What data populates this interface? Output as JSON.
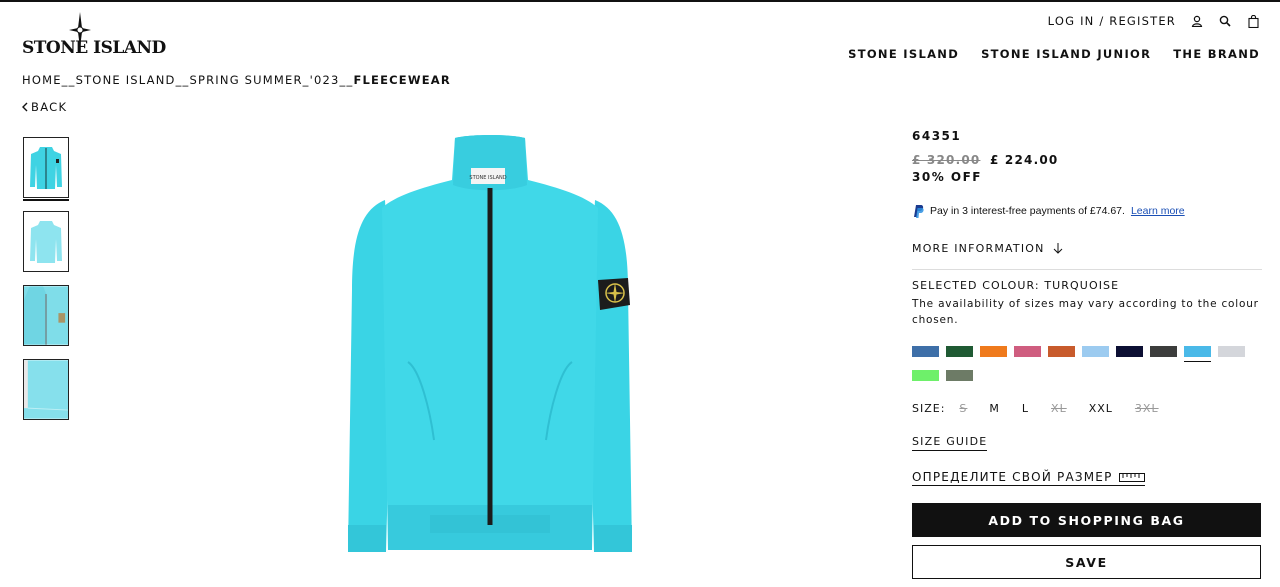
{
  "brand": {
    "logo_text": "STONE ISLAND"
  },
  "header": {
    "login_label": "LOG IN / REGISTER",
    "icons": [
      "user-icon",
      "search-icon",
      "bag-icon"
    ],
    "nav": [
      "STONE ISLAND",
      "STONE ISLAND JUNIOR",
      "THE BRAND"
    ]
  },
  "breadcrumb": {
    "path": "HOME__STONE ISLAND__SPRING SUMMER_'023__",
    "current": "FLEECEWEAR"
  },
  "back_label": "BACK",
  "gallery": {
    "thumb_count": 4,
    "selected_index": 0,
    "product_color": "#3fd3e3"
  },
  "product": {
    "sku": "64351",
    "price_original": "£ 320.00",
    "price_sale": "£ 224.00",
    "discount": "30% OFF",
    "paypal_text": "Pay in 3 interest-free payments of £74.67.",
    "paypal_link": "Learn more",
    "more_info_label": "MORE INFORMATION",
    "selected_colour": "SELECTED COLOUR: TURQUOISE",
    "availability_note": "The availability of sizes may vary according to the colour chosen.",
    "colours": [
      {
        "name": "blue",
        "hex": "#3e6fa8",
        "selected": false
      },
      {
        "name": "green",
        "hex": "#1f5a33",
        "selected": false
      },
      {
        "name": "orange",
        "hex": "#ef7a1c",
        "selected": false
      },
      {
        "name": "pink",
        "hex": "#cf5d7f",
        "selected": false
      },
      {
        "name": "rust",
        "hex": "#c85b2c",
        "selected": false
      },
      {
        "name": "sky-blue",
        "hex": "#9ccbf0",
        "selected": false
      },
      {
        "name": "navy",
        "hex": "#0c0f33",
        "selected": false
      },
      {
        "name": "charcoal",
        "hex": "#3c3d3c",
        "selected": false
      },
      {
        "name": "turquoise",
        "hex": "#4ab9e8",
        "selected": true
      },
      {
        "name": "light-grey",
        "hex": "#d4d6db",
        "selected": false
      },
      {
        "name": "lime",
        "hex": "#6ef06a",
        "selected": false
      },
      {
        "name": "sage",
        "hex": "#6d7b66",
        "selected": false
      }
    ],
    "size_label": "SIZE:",
    "sizes": [
      {
        "label": "S",
        "available": false
      },
      {
        "label": "M",
        "available": true
      },
      {
        "label": "L",
        "available": true
      },
      {
        "label": "XL",
        "available": false
      },
      {
        "label": "XXL",
        "available": true
      },
      {
        "label": "3XL",
        "available": false
      }
    ],
    "size_guide": "SIZE GUIDE",
    "fit_size_label": "ОПРЕДЕЛИТЕ СВОЙ РАЗМЕР",
    "add_to_bag": "ADD TO SHOPPING BAG",
    "save": "SAVE"
  }
}
